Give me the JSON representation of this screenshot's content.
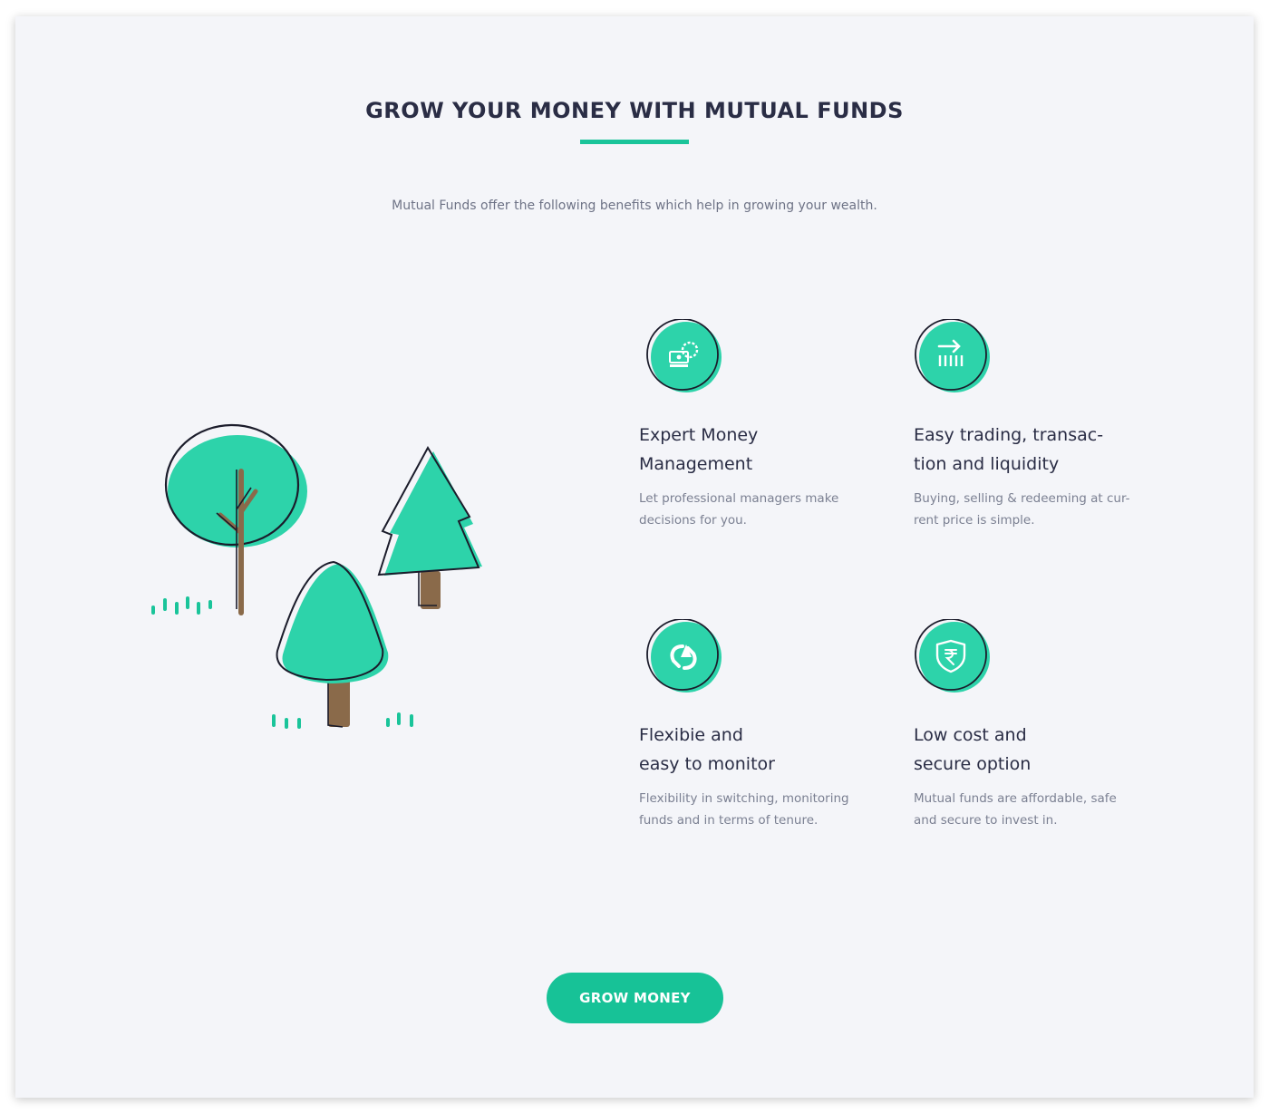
{
  "header": {
    "title": "GROW YOUR MONEY WITH MUTUAL FUNDS",
    "subtitle": "Mutual Funds offer the following benefits which help in growing your wealth."
  },
  "features": [
    {
      "icon": "money-gear-icon",
      "title": "Expert Money\nManagement",
      "description": "Let professional managers make\ndecisions for you."
    },
    {
      "icon": "trading-arrow-icon",
      "title": "Easy trading, transac-\ntion and liquidity",
      "description": "Buying, selling & redeeming at cur-\nrent price is simple."
    },
    {
      "icon": "switch-arrows-icon",
      "title": "Flexibie and\neasy to monitor",
      "description": "Flexibility in switching, monitoring\nfunds and in terms of tenure."
    },
    {
      "icon": "rupee-shield-icon",
      "title": "Low cost and\nsecure option",
      "description": "Mutual funds are affordable, safe\nand secure to invest in."
    }
  ],
  "cta": {
    "label": "GROW MONEY"
  },
  "colors": {
    "accent": "#17c297",
    "tree_green": "#2dd3aa",
    "trunk": "#8a6a4a",
    "text_dark": "#2a2d45"
  }
}
